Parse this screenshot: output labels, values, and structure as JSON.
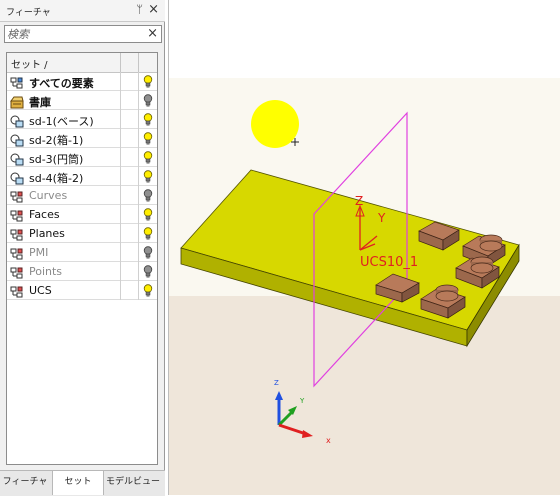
{
  "panel": {
    "title": "フィーチャ",
    "pin_glyph": "ᛘ",
    "close_glyph": "×",
    "search_placeholder": "検索",
    "search_clear_glyph": "×",
    "column_header": "セット /",
    "rows": [
      {
        "label": "すべての要素",
        "icon": "all-elements-icon",
        "style": "bold",
        "visible": true
      },
      {
        "label": "書庫",
        "icon": "library-icon",
        "style": "bold",
        "visible": false
      },
      {
        "label": "sd-1(ベース)",
        "icon": "set-icon",
        "style": "normal",
        "visible": true
      },
      {
        "label": "sd-2(箱-1)",
        "icon": "set-icon",
        "style": "normal",
        "visible": true
      },
      {
        "label": "sd-3(円筒)",
        "icon": "set-icon",
        "style": "normal",
        "visible": true
      },
      {
        "label": "sd-4(箱-2)",
        "icon": "set-icon",
        "style": "normal",
        "visible": true
      },
      {
        "label": "Curves",
        "icon": "category-icon",
        "style": "gray",
        "visible": false
      },
      {
        "label": "Faces",
        "icon": "category-icon",
        "style": "normal",
        "visible": true
      },
      {
        "label": "Planes",
        "icon": "category-icon",
        "style": "normal",
        "visible": true
      },
      {
        "label": "PMI",
        "icon": "category-icon",
        "style": "gray",
        "visible": false
      },
      {
        "label": "Points",
        "icon": "category-icon",
        "style": "gray",
        "visible": false
      },
      {
        "label": "UCS",
        "icon": "category-icon",
        "style": "normal",
        "visible": true
      }
    ],
    "tabs": [
      {
        "label": "フィーチャ",
        "active": false
      },
      {
        "label": "セット",
        "active": true
      },
      {
        "label": "モデルビュー",
        "active": false
      }
    ]
  },
  "viewport": {
    "ucs_label": "UCS10_1",
    "local_axes": {
      "z": "Z",
      "y": "Y"
    },
    "triad": {
      "x": "x",
      "y": "Y",
      "z": "Z"
    },
    "colors": {
      "plate": "#d7d800",
      "box": "#b87a5a",
      "plane": "#e040e0",
      "ucs": "#e02020",
      "sun": "#ffff00",
      "axis_x": "#e02020",
      "axis_y": "#20a020",
      "axis_z": "#2050e0"
    }
  }
}
